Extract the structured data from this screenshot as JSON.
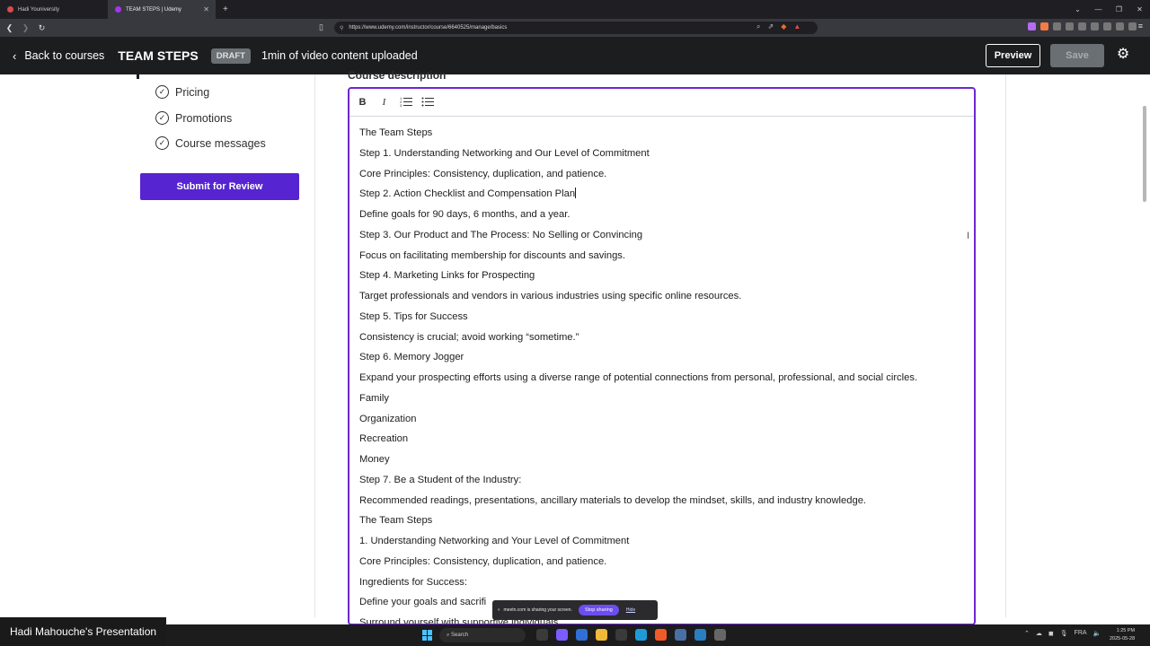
{
  "browser": {
    "tabs": [
      {
        "label": "Hadi Youniversity",
        "active": false
      },
      {
        "label": "TEAM STEPS | Udemy",
        "active": true
      }
    ],
    "url": "https://www.udemy.com/instructor/course/6640525/manage/basics"
  },
  "header": {
    "back_label": "Back to courses",
    "course_title": "TEAM STEPS",
    "status_badge": "DRAFT",
    "upload_status": "1min of video content uploaded",
    "preview_label": "Preview",
    "save_label": "Save"
  },
  "sidebar": {
    "items": [
      {
        "label": "Pricing",
        "checked": true
      },
      {
        "label": "Promotions",
        "checked": true
      },
      {
        "label": "Course messages",
        "checked": true
      }
    ],
    "submit_label": "Submit for Review"
  },
  "main": {
    "section_label": "Course description",
    "toolbar": [
      "B",
      "I",
      "ordered-list",
      "bullet-list"
    ],
    "description_lines": [
      "The Team Steps",
      "Step 1. Understanding Networking and Our Level of Commitment",
      "Core Principles: Consistency, duplication, and patience.",
      "Step 2. Action Checklist and Compensation Plan",
      "Define goals for 90 days, 6 months, and a year.",
      "Step 3. Our Product and The Process: No Selling or Convincing",
      "Focus on facilitating membership for discounts and savings.",
      "Step 4. Marketing Links for Prospecting",
      "Target professionals and vendors in various industries using specific online resources.",
      "Step 5. Tips for Success",
      "Consistency is crucial; avoid working “sometime.”",
      "Step 6. Memory Jogger",
      "Expand your prospecting efforts using a diverse range of potential connections from personal, professional, and social circles.",
      "Family",
      "Organization",
      "Recreation",
      "Money",
      "Step 7. Be a Student of the Industry:",
      "Recommended readings, presentations, ancillary materials to develop the mindset, skills, and industry knowledge.",
      "The Team Steps",
      "1. Understanding Networking and Your Level of Commitment",
      "Core Principles: Consistency, duplication, and patience.",
      "Ingredients for Success:",
      "Define your goals and sacrifi",
      "Surround yourself with supportive individuals"
    ]
  },
  "screen_share": {
    "message": "meetn.com is sharing your screen.",
    "stop_label": "Stop sharing",
    "hide_label": "Hide"
  },
  "presenter_label": "Hadi Mahouche's Presentation",
  "taskbar": {
    "search_label": "Search",
    "language": "FRA",
    "time": "1:25 PM",
    "date": "2025-05-28"
  },
  "colors": {
    "accent": "#5624d0",
    "editor_border": "#6d28d2",
    "header_bg": "#1c1d1f"
  }
}
